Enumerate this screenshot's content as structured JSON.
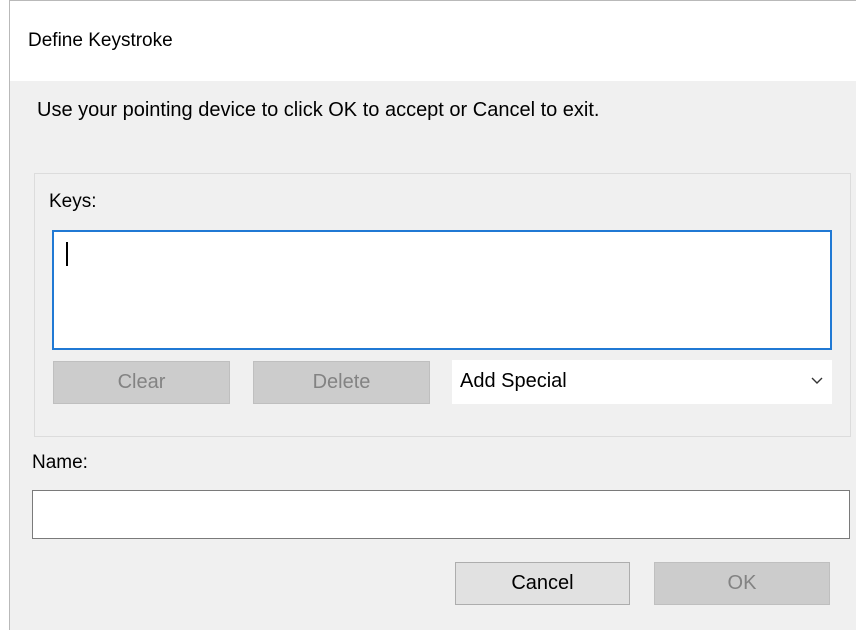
{
  "window": {
    "title": "Define Keystroke"
  },
  "instruction": "Use your pointing device to click OK to accept or Cancel to exit.",
  "keys": {
    "label": "Keys:",
    "value": ""
  },
  "buttons": {
    "clear": "Clear",
    "delete": "Delete",
    "cancel": "Cancel",
    "ok": "OK"
  },
  "add_special": {
    "selected": "Add Special",
    "icon": "chevron-down-icon"
  },
  "name": {
    "label": "Name:",
    "value": ""
  },
  "colors": {
    "focus_border": "#2079d4",
    "disabled_button": "#cccccc",
    "dialog_background": "#f0f0f0"
  }
}
